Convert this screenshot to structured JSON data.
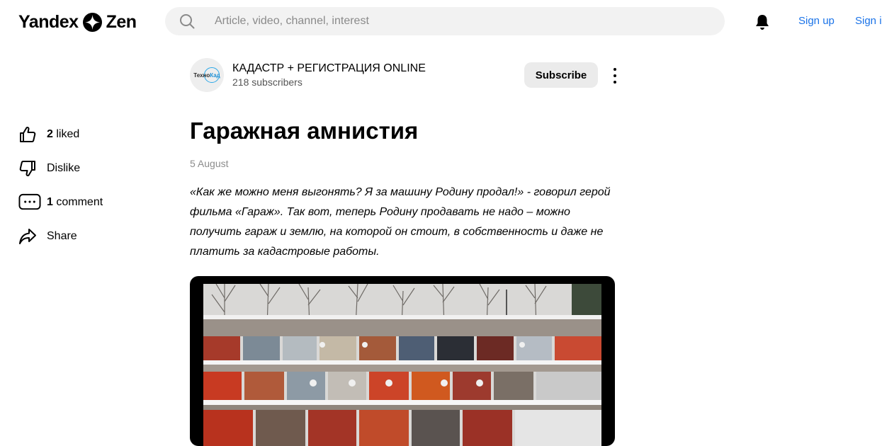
{
  "header": {
    "logo_left": "Yandex",
    "logo_right": "Zen",
    "search_placeholder": "Article, video, channel, interest",
    "signup_label": "Sign up",
    "signin_label": "Sign in"
  },
  "rail": {
    "likes_count": "2",
    "likes_label": "liked",
    "dislike_label": "Dislike",
    "comments_count": "1",
    "comments_label": "comment",
    "share_label": "Share"
  },
  "channel": {
    "avatar_text_left": "Техно",
    "avatar_text_right": "Кад",
    "name": "КАДАСТР + РЕГИСТРАЦИЯ ONLINE",
    "subscribers": "218 subscribers",
    "subscribe_label": "Subscribe"
  },
  "article": {
    "title": "Гаражная амнистия",
    "date": "5 August",
    "lead": "«Как же можно меня выгонять? Я за машину Родину продал!» - говорил герой фильма «Гараж». Так вот, теперь Родину продавать не надо – можно получить гараж и землю, на которой он стоит, в собственность и даже не платить за кадастровые работы."
  },
  "icons": {
    "search": "search-icon",
    "bell": "bell-icon",
    "like": "thumbs-up-icon",
    "dislike": "thumbs-down-icon",
    "comment": "comment-icon",
    "share": "share-icon",
    "more": "more-vertical-icon"
  },
  "colors": {
    "link": "#1a73e8",
    "search_bg": "#f2f2f2",
    "button_bg": "#ebebeb"
  }
}
